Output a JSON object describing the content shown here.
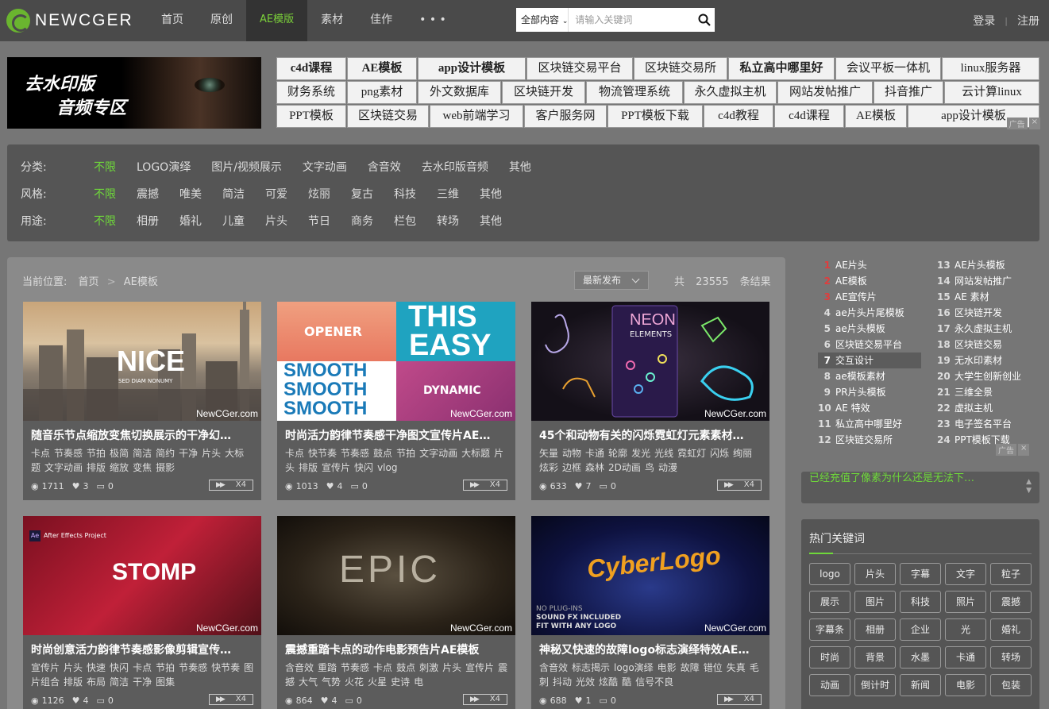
{
  "header": {
    "logo_text": "NEWCGER",
    "nav": [
      "首页",
      "原创",
      "AE模版",
      "素材",
      "佳作",
      "• • •"
    ],
    "nav_active": 2,
    "search_category": "全部内容",
    "search_placeholder": "请输入关键词",
    "login": "登录",
    "register": "注册",
    "accent": "#7bd13a"
  },
  "banner": {
    "line1": "去水印版",
    "line2": "音频专区"
  },
  "keyword_rows": [
    [
      "c4d课程",
      "AE模板",
      "app设计模板",
      "区块链交易平台",
      "区块链交易所",
      "私立高中哪里好",
      "会议平板一体机",
      "linux服务器"
    ],
    [
      "财务系统",
      "png素材",
      "外文数据库",
      "区块链开发",
      "物流管理系统",
      "永久虚拟主机",
      "网站发帖推广",
      "抖音推广",
      "云计算linux"
    ],
    [
      "PPT模板",
      "区块链交易",
      "web前端学习",
      "客户服务网",
      "PPT模板下载",
      "c4d教程",
      "c4d课程",
      "AE模板",
      "app设计模板"
    ]
  ],
  "ad_label": "广告",
  "ad_close": "×",
  "filters": [
    {
      "label": "分类:",
      "options": [
        "不限",
        "LOGO演绎",
        "图片/视频展示",
        "文字动画",
        "含音效",
        "去水印版音频",
        "其他"
      ]
    },
    {
      "label": "风格:",
      "options": [
        "不限",
        "震撼",
        "唯美",
        "简洁",
        "可爱",
        "炫丽",
        "复古",
        "科技",
        "三维",
        "其他"
      ]
    },
    {
      "label": "用途:",
      "options": [
        "不限",
        "相册",
        "婚礼",
        "儿童",
        "片头",
        "节日",
        "商务",
        "栏包",
        "转场",
        "其他"
      ]
    }
  ],
  "breadcrumb": {
    "label": "当前位置:",
    "home": "首页",
    "sep": ">",
    "current": "AE模板"
  },
  "sort": "最新发布",
  "result_count": {
    "prefix": "共",
    "value": "23555",
    "suffix": "条结果"
  },
  "watermark": "NewCGer.com",
  "cards": [
    {
      "title": "随音乐节点缩放变焦切换展示的干净幻…",
      "tags": [
        "卡点",
        "节奏感",
        "节拍",
        "极简",
        "简洁",
        "简约",
        "干净",
        "片头",
        "大标题",
        "文字动画",
        "排版",
        "缩放",
        "变焦",
        "摄影"
      ],
      "views": "1711",
      "likes": "3",
      "comments": "0",
      "speed": "X4",
      "thumb_text": "NICE",
      "thumb_sub": "SED DIAM NONUMY"
    },
    {
      "title": "时尚活力韵律节奏感干净图文宣传片AE…",
      "tags": [
        "卡点",
        "快节奏",
        "节奏感",
        "鼓点",
        "节拍",
        "文字动画",
        "大标题",
        "片头",
        "排版",
        "宣传片",
        "快闪",
        "vlog"
      ],
      "views": "1013",
      "likes": "4",
      "comments": "0",
      "speed": "X4",
      "thumb_text": [
        "OPENER",
        "THIS",
        "EASY",
        "SMOOTH",
        "SMOOTH",
        "SMOOTH",
        "DYNAMIC"
      ]
    },
    {
      "title": "45个和动物有关的闪烁霓虹灯元素素材…",
      "tags": [
        "矢量",
        "动物",
        "卡通",
        "轮廓",
        "发光",
        "光线",
        "霓虹灯",
        "闪烁",
        "绚丽",
        "炫彩",
        "边框",
        "森林",
        "2D动画",
        "鸟",
        "动漫"
      ],
      "views": "633",
      "likes": "7",
      "comments": "0",
      "speed": "X4",
      "thumb_text": "NEON",
      "thumb_sub": "ELEMENTS"
    },
    {
      "title": "时尚创意活力韵律节奏感影像剪辑宣传…",
      "tags": [
        "宣传片",
        "片头",
        "快速",
        "快闪",
        "卡点",
        "节拍",
        "节奏感",
        "快节奏",
        "图片组合",
        "排版",
        "布局",
        "简洁",
        "干净",
        "图集"
      ],
      "views": "1126",
      "likes": "4",
      "comments": "0",
      "speed": "X4",
      "thumb_text": "STOMP",
      "thumb_sub": "After Effects Project"
    },
    {
      "title": "震撼重踏卡点的动作电影预告片AE模板",
      "tags": [
        "含音效",
        "重踏",
        "节奏感",
        "卡点",
        "鼓点",
        "刺激",
        "片头",
        "宣传片",
        "震撼",
        "大气",
        "气势",
        "火花",
        "火星",
        "史诗",
        "电"
      ],
      "views": "864",
      "likes": "4",
      "comments": "0",
      "speed": "X4",
      "thumb_text": "EPIC"
    },
    {
      "title": "神秘又快速的故障logo标志演绎特效AE…",
      "tags": [
        "含音效",
        "标志揭示",
        "logo演绎",
        "电影",
        "故障",
        "错位",
        "失真",
        "毛刺",
        "抖动",
        "光效",
        "炫酷",
        "酷",
        "信号不良"
      ],
      "views": "688",
      "likes": "1",
      "comments": "0",
      "speed": "X4",
      "thumb_text": "CyberLogo",
      "thumb_sub": [
        "NO PLUG-INS",
        "SOUND FX INCLUDED",
        "FIT WITH ANY LOGO"
      ]
    }
  ],
  "ranking": {
    "left": [
      {
        "n": "1",
        "t": "AE片头"
      },
      {
        "n": "2",
        "t": "AE模板"
      },
      {
        "n": "3",
        "t": "AE宣传片"
      },
      {
        "n": "4",
        "t": "ae片头片尾模板"
      },
      {
        "n": "5",
        "t": "ae片头模板"
      },
      {
        "n": "6",
        "t": "区块链交易平台"
      },
      {
        "n": "7",
        "t": "交互设计"
      },
      {
        "n": "8",
        "t": "ae模板素材"
      },
      {
        "n": "9",
        "t": "PR片头模板"
      },
      {
        "n": "10",
        "t": "AE 特效"
      },
      {
        "n": "11",
        "t": "私立高中哪里好"
      },
      {
        "n": "12",
        "t": "区块链交易所"
      }
    ],
    "right": [
      {
        "n": "13",
        "t": "AE片头模板"
      },
      {
        "n": "14",
        "t": "网站发帖推广"
      },
      {
        "n": "15",
        "t": "AE 素材"
      },
      {
        "n": "16",
        "t": "区块链开发"
      },
      {
        "n": "17",
        "t": "永久虚拟主机"
      },
      {
        "n": "18",
        "t": "区块链交易"
      },
      {
        "n": "19",
        "t": "无水印素材"
      },
      {
        "n": "20",
        "t": "大学生创新创业"
      },
      {
        "n": "21",
        "t": "三维全景"
      },
      {
        "n": "22",
        "t": "虚拟主机"
      },
      {
        "n": "23",
        "t": "电子签名平台"
      },
      {
        "n": "24",
        "t": "PPT模板下载"
      }
    ],
    "highlight": "7",
    "ad_label": "广告"
  },
  "marquee": "已经充值了像素为什么还是无法下…",
  "hot": {
    "title": "热门关键词",
    "keywords": [
      "logo",
      "片头",
      "字幕",
      "文字",
      "粒子",
      "展示",
      "图片",
      "科技",
      "照片",
      "震撼",
      "字幕条",
      "相册",
      "企业",
      "光",
      "婚礼",
      "时尚",
      "背景",
      "水墨",
      "卡通",
      "转场",
      "动画",
      "倒计时",
      "新闻",
      "电影",
      "包装"
    ]
  }
}
